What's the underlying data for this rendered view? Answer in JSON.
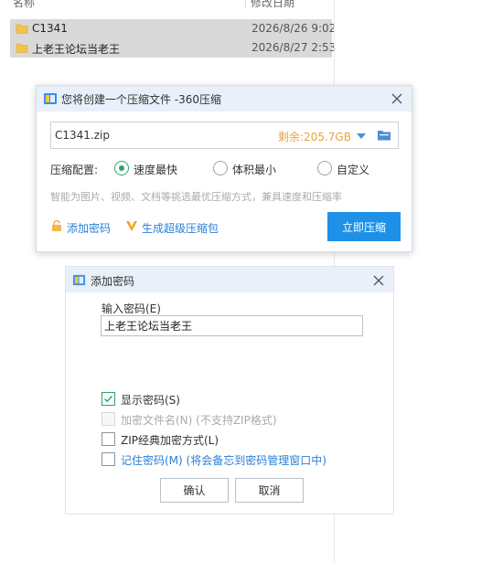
{
  "explorer": {
    "columns": {
      "name": "名称",
      "date": "修改日期"
    },
    "files": [
      {
        "name": "C1341",
        "date": "2026/8/26 9:02"
      },
      {
        "name": "上老王论坛当老王",
        "date": "2026/8/27 2:53"
      }
    ]
  },
  "compress_dialog": {
    "title": "您将创建一个压缩文件 -360压缩",
    "path": "C1341.zip",
    "free_space": "剩余:205.7GB",
    "config_label": "压缩配置:",
    "options": [
      {
        "label": "速度最快",
        "checked": true
      },
      {
        "label": "体积最小",
        "checked": false
      },
      {
        "label": "自定义",
        "checked": false
      }
    ],
    "hint": "智能为图片、视频、文档等挑选最优压缩方式，兼具速度和压缩率",
    "add_password_link": "添加密码",
    "super_pack_link": "生成超级压缩包",
    "compress_button": "立即压缩"
  },
  "password_dialog": {
    "title": "添加密码",
    "input_label": "输入密码(E)",
    "password_value": "上老王论坛当老王",
    "checkboxes": [
      {
        "label": "显示密码(S)",
        "checked": true,
        "disabled": false
      },
      {
        "label": "加密文件名(N) (不支持ZIP格式)",
        "checked": false,
        "disabled": true
      },
      {
        "label": "ZIP经典加密方式(L)",
        "checked": false,
        "disabled": false
      },
      {
        "label": "记住密码(M) (将会备忘到密码管理窗口中)",
        "checked": false,
        "disabled": false
      }
    ],
    "ok_button": "确认",
    "cancel_button": "取消"
  },
  "colors": {
    "accent_blue": "#1e90e8",
    "link_blue": "#2a7fd4",
    "space_orange": "#e8a33a",
    "check_green": "#2aa66a"
  }
}
